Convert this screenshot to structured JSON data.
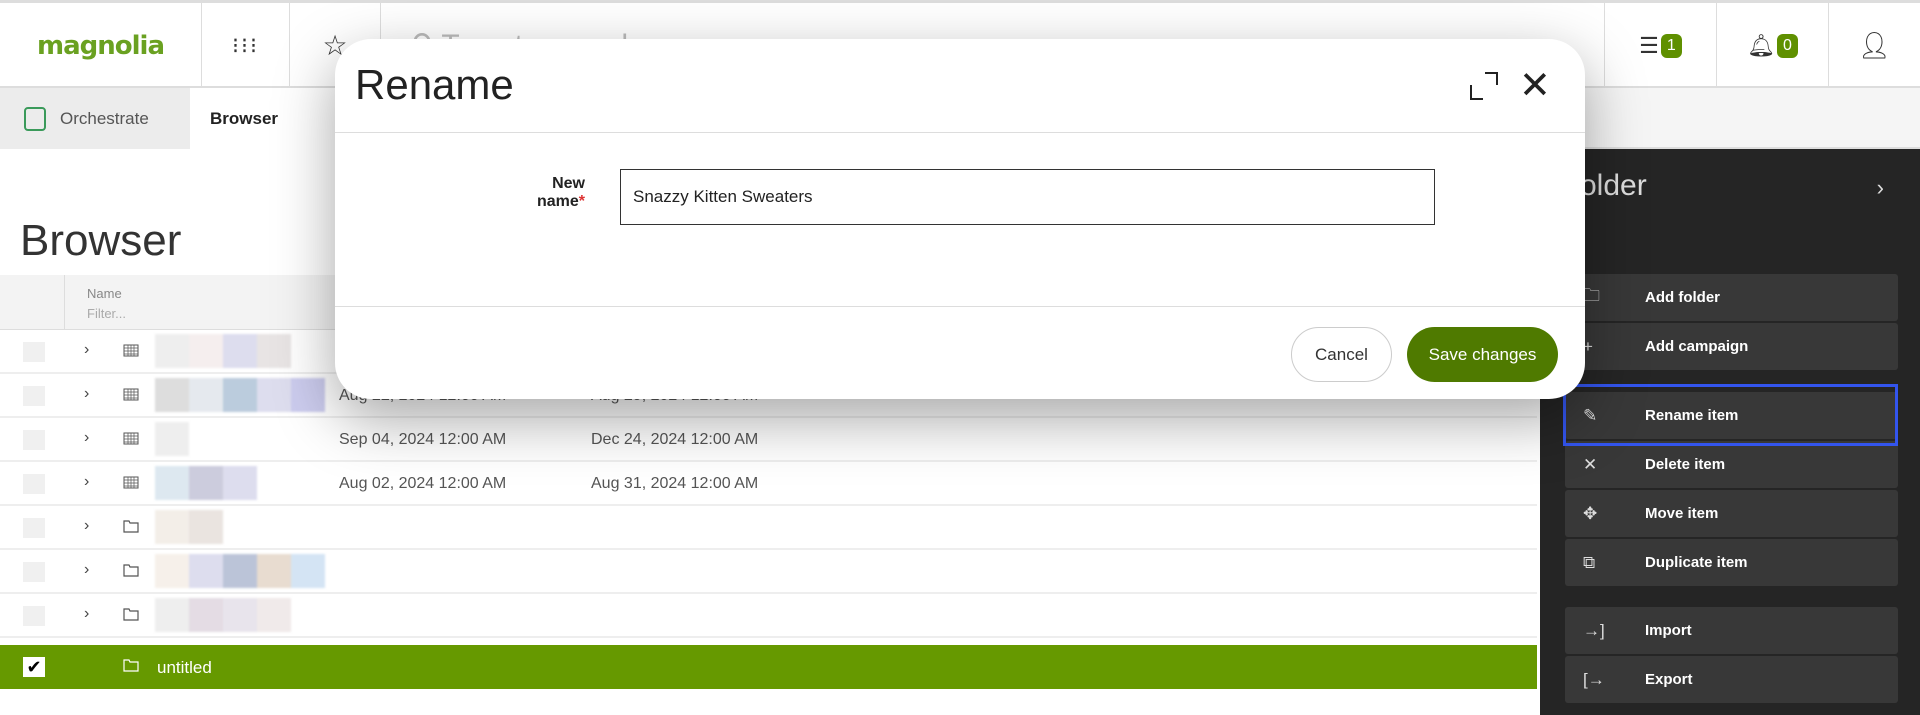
{
  "header": {
    "logo": "magnolia",
    "search_placeholder": "Type to search",
    "tasks_count": "1",
    "notifications_count": "0",
    "brand_color": "#6aa121",
    "badge_color": "#5f9000"
  },
  "tabs": [
    {
      "label": "Orchestrate"
    },
    {
      "label": "Browser",
      "active": true
    }
  ],
  "page": {
    "title": "Browser"
  },
  "table": {
    "name_header": "Name",
    "filter_placeholder": "Filter...",
    "rows": [
      {
        "icon": "calendar-icon",
        "start": "",
        "end": ""
      },
      {
        "icon": "calendar-icon",
        "start": "Aug 22, 2024 12:00 AM",
        "end": "Aug 29, 2024 12:00 AM"
      },
      {
        "icon": "calendar-icon",
        "start": "Sep 04, 2024 12:00 AM",
        "end": "Dec 24, 2024 12:00 AM"
      },
      {
        "icon": "calendar-icon",
        "start": "Aug 02, 2024 12:00 AM",
        "end": "Aug 31, 2024 12:00 AM"
      },
      {
        "icon": "folder-icon",
        "start": "",
        "end": ""
      },
      {
        "icon": "folder-icon",
        "start": "",
        "end": ""
      },
      {
        "icon": "folder-icon",
        "start": "",
        "end": ""
      }
    ],
    "selected_row": {
      "name": "untitled",
      "icon": "folder-icon",
      "selected_color": "#669900"
    }
  },
  "panel": {
    "title": "older",
    "actions": [
      {
        "label": "Add folder",
        "icon": "add-folder-icon"
      },
      {
        "label": "Add campaign",
        "icon": "plus-icon"
      },
      {
        "label": "Rename item",
        "icon": "pencil-icon",
        "highlighted": true
      },
      {
        "label": "Delete item",
        "icon": "x-icon"
      },
      {
        "label": "Move item",
        "icon": "move-icon"
      },
      {
        "label": "Duplicate item",
        "icon": "duplicate-icon"
      },
      {
        "label": "Import",
        "icon": "import-icon"
      },
      {
        "label": "Export",
        "icon": "export-icon"
      }
    ]
  },
  "modal": {
    "title": "Rename",
    "field_label": "New name",
    "required_mark": "*",
    "field_value": "Snazzy Kitten Sweaters",
    "cancel_label": "Cancel",
    "save_label": "Save changes",
    "save_color": "#4f7a00"
  }
}
